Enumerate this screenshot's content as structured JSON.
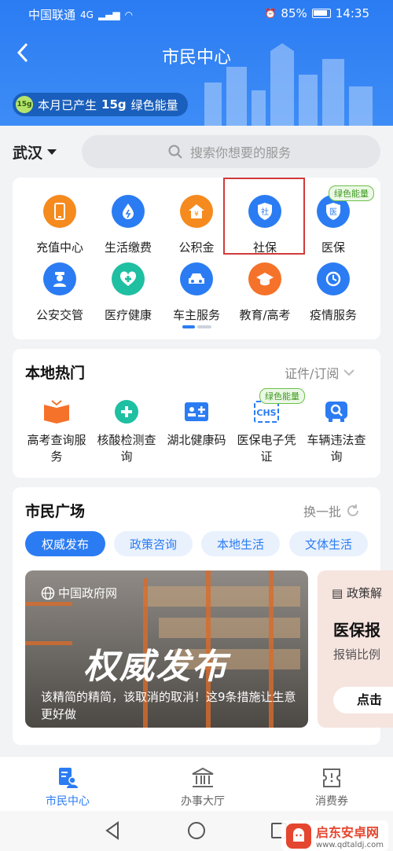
{
  "status_bar": {
    "carrier": "中国联通",
    "network": "4G",
    "battery": "85%",
    "time": "14:35"
  },
  "header": {
    "title": "市民中心",
    "energy_prefix": "本月已产生",
    "energy_value": "15g",
    "energy_suffix": "绿色能量",
    "energy_badge": "15g"
  },
  "location": {
    "city": "武汉"
  },
  "search": {
    "placeholder": "搜索你想要的服务"
  },
  "services": [
    {
      "label": "充值中心",
      "icon": "phone-icon",
      "color": "#f58a1f"
    },
    {
      "label": "生活缴费",
      "icon": "water-drop-icon",
      "color": "#2b7cf3"
    },
    {
      "label": "公积金",
      "icon": "yuan-house-icon",
      "color": "#f58a1f"
    },
    {
      "label": "社保",
      "icon": "shield-icon",
      "color": "#2b7cf3",
      "glyph": "社"
    },
    {
      "label": "医保",
      "icon": "medical-shield-icon",
      "color": "#2b7cf3",
      "glyph": "医",
      "tag": "绿色能量"
    },
    {
      "label": "公安交管",
      "icon": "police-icon",
      "color": "#2b7cf3"
    },
    {
      "label": "医疗健康",
      "icon": "medical-cross-icon",
      "color": "#1fbfa2"
    },
    {
      "label": "车主服务",
      "icon": "car-icon",
      "color": "#2b7cf3"
    },
    {
      "label": "教育/高考",
      "icon": "graduation-cap-icon",
      "color": "#f5722a"
    },
    {
      "label": "疫情服务",
      "icon": "clock-refresh-icon",
      "color": "#2b7cf3"
    }
  ],
  "hot": {
    "title": "本地热门",
    "right": "证件/订阅",
    "items": [
      {
        "label": "高考查询服务",
        "icon": "book-icon",
        "color": "#f5722a"
      },
      {
        "label": "核酸检测查询",
        "icon": "heart-shield-icon",
        "color": "#1fbfa2"
      },
      {
        "label": "湖北健康码",
        "icon": "health-card-icon",
        "color": "#2b7cf3"
      },
      {
        "label": "医保电子凭证",
        "icon": "chs-icon",
        "color": "#2b7cf3",
        "tag": "绿色能量",
        "glyph": "CHS"
      },
      {
        "label": "车辆违法查询",
        "icon": "car-search-icon",
        "color": "#2b7cf3"
      }
    ]
  },
  "plaza": {
    "title": "市民广场",
    "refresh": "换一批",
    "chips": [
      "权威发布",
      "政策咨询",
      "本地生活",
      "文体生活"
    ],
    "banner": {
      "source": "中国政府网",
      "big": "权威发布",
      "caption": "该精简的精简，该取消的取消！这9条措施让生意更好做"
    },
    "banner2": {
      "source": "政策解",
      "title": "医保报",
      "sub": "报销比例",
      "button": "点击"
    }
  },
  "bottom_nav": [
    {
      "label": "市民中心",
      "icon": "citizen-card-icon",
      "active": true
    },
    {
      "label": "办事大厅",
      "icon": "hall-building-icon",
      "active": false
    },
    {
      "label": "消费券",
      "icon": "coupon-icon",
      "active": false
    }
  ],
  "watermark": {
    "title": "启东安卓网",
    "url": "www.qdtaldj.com"
  }
}
